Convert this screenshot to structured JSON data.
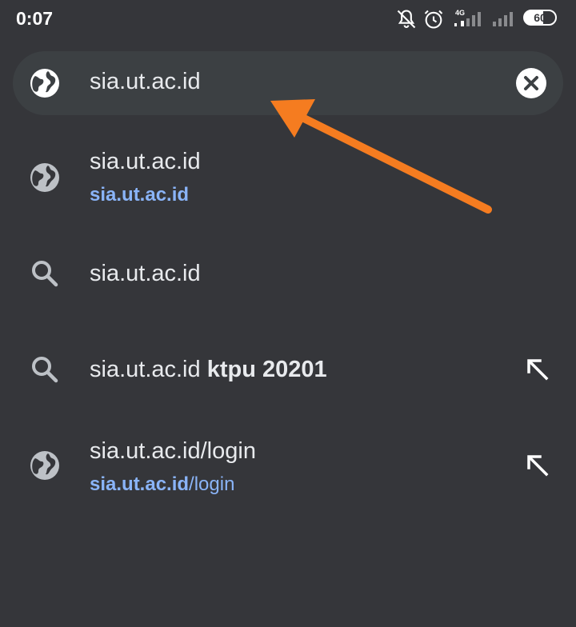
{
  "status_bar": {
    "time": "0:07",
    "network_label": "4G",
    "battery": "60",
    "icons": [
      "bell-muted-icon",
      "alarm-icon",
      "signal-icon",
      "signal-icon",
      "battery-icon"
    ]
  },
  "omnibox": {
    "value": "sia.ut.ac.id",
    "left_icon": "globe-icon",
    "right_icon": "clear-icon"
  },
  "suggestions": [
    {
      "icon": "globe-icon",
      "title": "sia.ut.ac.id",
      "url_bold": "sia.ut.ac.id",
      "url_rest": ""
    },
    {
      "icon": "search-icon",
      "title": "sia.ut.ac.id"
    },
    {
      "icon": "search-icon",
      "title": "sia.ut.ac.id ",
      "title_bold": "ktpu 20201",
      "action_icon": "arrow-up-left-icon"
    },
    {
      "icon": "globe-icon",
      "title": "sia.ut.ac.id/login",
      "url_bold": "sia.ut.ac.id",
      "url_rest": "/login",
      "action_icon": "arrow-up-left-icon"
    }
  ],
  "colors": {
    "background": "#35363a",
    "omnibox": "#3c4043",
    "text": "#e8eaed",
    "link": "#8ab4f8",
    "annotation_arrow": "#f57c20"
  }
}
